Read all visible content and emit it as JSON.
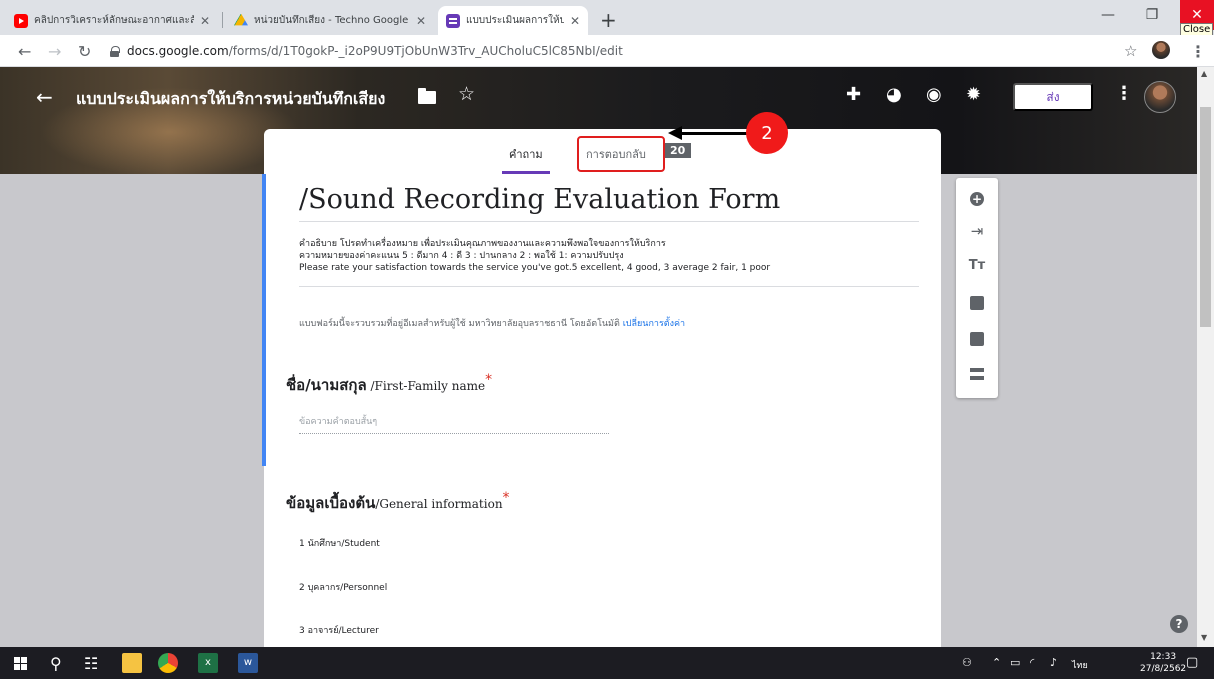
{
  "browser": {
    "tabs": [
      {
        "title": "คลิปการวิเคราะห์ลักษณะอากาศและลั",
        "icon": "youtube-icon"
      },
      {
        "title": "หน่วยบันทึกเสียง - Techno Google",
        "icon": "google-drive-icon"
      },
      {
        "title": "แบบประเมินผลการให้บริการหน่วยบันทึ",
        "icon": "google-forms-icon"
      }
    ],
    "close_tooltip": "Close",
    "url_host": "docs.google.com",
    "url_path": "/forms/d/1T0gokP-_i2oP9U9TjObUnW3Trv_AUCholuC5lC85NbI/edit"
  },
  "header": {
    "form_title": "แบบประเมินผลการให้บริการหน่วยบันทึกเสียง",
    "send_label": "ส่ง"
  },
  "tabs": {
    "questions_label": "คำถาม",
    "responses_label": "การตอบกลับ",
    "responses_count": "20"
  },
  "annotation": {
    "callout_number": "2"
  },
  "form": {
    "title": "/Sound Recording Evaluation Form",
    "description_lines": [
      "คำอธิบาย  โปรดทำเครื่องหมาย เพื่อประเมินคุณภาพของงานและความพึงพอใจของการให้บริการ",
      "ความหมายของค่าคะแนน 5 : ดีมาก 4 : ดี  3 : ปานกลาง  2 : พอใช้  1: ความปรับปรุง",
      "Please rate your satisfaction towards the service you've got.5 excellent, 4 good, 3 average 2 fair, 1 poor"
    ],
    "collect_note": "แบบฟอร์มนี้จะรวบรวมที่อยู่อีเมลสำหรับผู้ใช้ มหาวิทยาลัยอุบลราชธานี โดยอัตโนมัติ",
    "collect_link": "เปลี่ยนการตั้งค่า",
    "q1": {
      "title_th": "ชื่อ/นามสกุล",
      "title_en": " /First-Family name",
      "required_mark": "*",
      "placeholder": "ข้อความคำตอบสั้นๆ"
    },
    "q2": {
      "title_th": "ข้อมูลเบื้องต้น",
      "title_en": "/General information",
      "required_mark": "*",
      "options": [
        "1  นักศึกษา/Student",
        "2  บุคลากร/Personnel",
        "3  อาจารย์/Lecturer"
      ]
    }
  },
  "taskbar": {
    "language": "ไทย",
    "time": "12:33",
    "date": "27/8/2562"
  }
}
